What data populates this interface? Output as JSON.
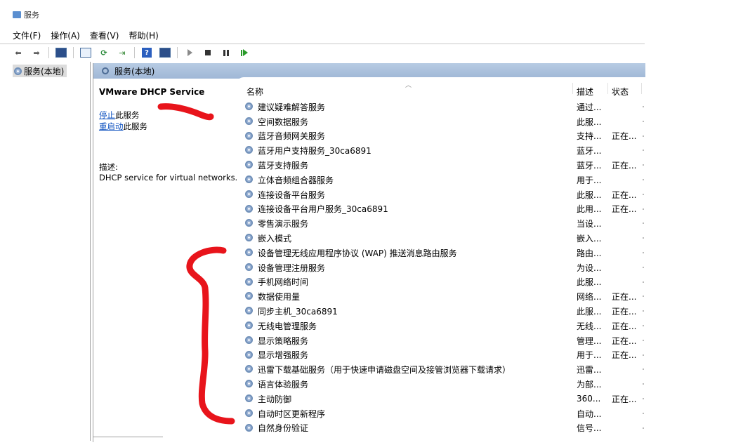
{
  "window": {
    "title": "服务"
  },
  "menu": [
    "文件(F)",
    "操作(A)",
    "查看(V)",
    "帮助(H)"
  ],
  "tree": {
    "item": "服务(本地)"
  },
  "panel": {
    "header": "服务(本地)",
    "service_name": "VMware DHCP Service",
    "stop_link": "停止",
    "stop_suffix": "此服务",
    "restart_link": "重启动",
    "restart_suffix": "此服务",
    "desc_label": "描述:",
    "desc_text": "DHCP service for virtual networks."
  },
  "list": {
    "columns": {
      "name": "名称",
      "desc": "描述",
      "status": "状态"
    },
    "rows": [
      {
        "name": "建议疑难解答服务",
        "desc": "通过...",
        "status": ""
      },
      {
        "name": "空间数据服务",
        "desc": "此服...",
        "status": ""
      },
      {
        "name": "蓝牙音频网关服务",
        "desc": "支持...",
        "status": "正在..."
      },
      {
        "name": "蓝牙用户支持服务_30ca6891",
        "desc": "蓝牙...",
        "status": ""
      },
      {
        "name": "蓝牙支持服务",
        "desc": "蓝牙...",
        "status": "正在..."
      },
      {
        "name": "立体音频组合器服务",
        "desc": "用于...",
        "status": ""
      },
      {
        "name": "连接设备平台服务",
        "desc": "此服...",
        "status": "正在..."
      },
      {
        "name": "连接设备平台用户服务_30ca6891",
        "desc": "此用...",
        "status": "正在..."
      },
      {
        "name": "零售演示服务",
        "desc": "当设...",
        "status": ""
      },
      {
        "name": "嵌入模式",
        "desc": "嵌入...",
        "status": ""
      },
      {
        "name": "设备管理无线应用程序协议 (WAP) 推送消息路由服务",
        "desc": "路由...",
        "status": ""
      },
      {
        "name": "设备管理注册服务",
        "desc": "为设...",
        "status": ""
      },
      {
        "name": "手机网络时间",
        "desc": "此服...",
        "status": ""
      },
      {
        "name": "数据使用量",
        "desc": "网络...",
        "status": "正在..."
      },
      {
        "name": "同步主机_30ca6891",
        "desc": "此服...",
        "status": "正在..."
      },
      {
        "name": "无线电管理服务",
        "desc": "无线...",
        "status": "正在..."
      },
      {
        "name": "显示策略服务",
        "desc": "管理...",
        "status": "正在..."
      },
      {
        "name": "显示增强服务",
        "desc": "用于...",
        "status": "正在..."
      },
      {
        "name": "迅雷下载基础服务（用于快速申请磁盘空间及接管浏览器下载请求）",
        "desc": "迅雷...",
        "status": ""
      },
      {
        "name": "语言体验服务",
        "desc": "为部...",
        "status": ""
      },
      {
        "name": "主动防御",
        "desc": "360...",
        "status": "正在..."
      },
      {
        "name": "自动时区更新程序",
        "desc": "自动...",
        "status": ""
      },
      {
        "name": "自然身份验证",
        "desc": "信号...",
        "status": ""
      }
    ]
  },
  "annotation_color": "#e8141b"
}
